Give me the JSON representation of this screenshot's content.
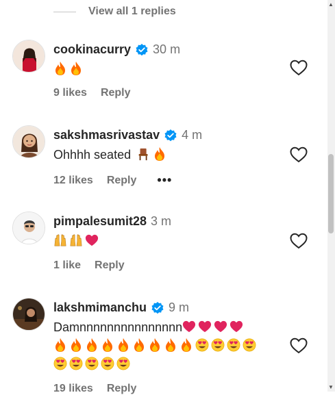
{
  "view_replies": "View all 1 replies",
  "comments": [
    {
      "username": "cookinacurry",
      "verified": true,
      "time": "30 m",
      "text": "",
      "emojis": [
        "fire",
        "fire"
      ],
      "likes": "9 likes",
      "reply": "Reply"
    },
    {
      "username": "sakshmasrivastav",
      "verified": true,
      "time": "4 m",
      "text": "Ohhhh seated",
      "emojis": [
        "chair",
        "fire"
      ],
      "likes": "12 likes",
      "reply": "Reply",
      "more": "•••"
    },
    {
      "username": "pimpalesumit28",
      "verified": false,
      "time": "3 m",
      "text": "",
      "emojis": [
        "raised-hands",
        "raised-hands",
        "heart"
      ],
      "likes": "1 like",
      "reply": "Reply"
    },
    {
      "username": "lakshmimanchu",
      "verified": true,
      "time": "9 m",
      "text": "Damnnnnnnnnnnnnnnn",
      "emojis_line1": [
        "heart",
        "heart",
        "heart",
        "heart"
      ],
      "emojis_line2": [
        "fire",
        "fire",
        "fire",
        "fire",
        "fire",
        "fire",
        "fire",
        "fire",
        "fire",
        "heart-eyes",
        "heart-eyes",
        "heart-eyes",
        "heart-eyes"
      ],
      "emojis_line3": [
        "heart-eyes",
        "heart-eyes",
        "heart-eyes",
        "heart-eyes",
        "heart-eyes"
      ],
      "likes": "19 likes",
      "reply": "Reply"
    }
  ],
  "colors": {
    "verified": "#0095f6",
    "heart": "#e0245e",
    "fire": "#ff7a00",
    "muted": "#737373"
  }
}
